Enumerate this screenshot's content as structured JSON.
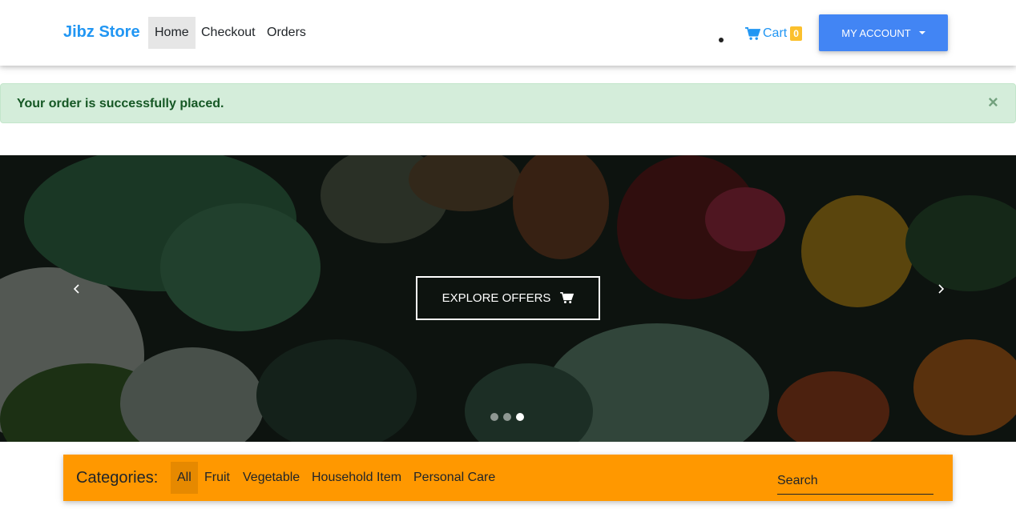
{
  "navbar": {
    "brand": "Jibz Store",
    "links": [
      {
        "label": "Home",
        "active": true
      },
      {
        "label": "Checkout",
        "active": false
      },
      {
        "label": "Orders",
        "active": false
      }
    ],
    "cart": {
      "label": "Cart",
      "count": "0",
      "icon": "shopping-cart-icon"
    },
    "account_button": "My Account",
    "colors": {
      "brand": "#2196f3",
      "account_button": "#4285f4",
      "badge": "#fbc02d"
    }
  },
  "alert": {
    "message": "Your order is successfully placed.",
    "close": "×",
    "colors": {
      "background": "#d4edda",
      "text": "#155724"
    }
  },
  "carousel": {
    "button_label": "Explore Offers",
    "button_icon": "shopping-cart-icon",
    "indicators": 3,
    "active_indicator": 3,
    "prev_icon": "chevron-left-icon",
    "next_icon": "chevron-right-icon"
  },
  "categories": {
    "title": "Categories:",
    "items": [
      {
        "label": "All",
        "active": true
      },
      {
        "label": "Fruit",
        "active": false
      },
      {
        "label": "Vegetable",
        "active": false
      },
      {
        "label": "Household Item",
        "active": false
      },
      {
        "label": "Personal Care",
        "active": false
      }
    ],
    "search_placeholder": "Search",
    "colors": {
      "bar": "#ff9800"
    }
  }
}
